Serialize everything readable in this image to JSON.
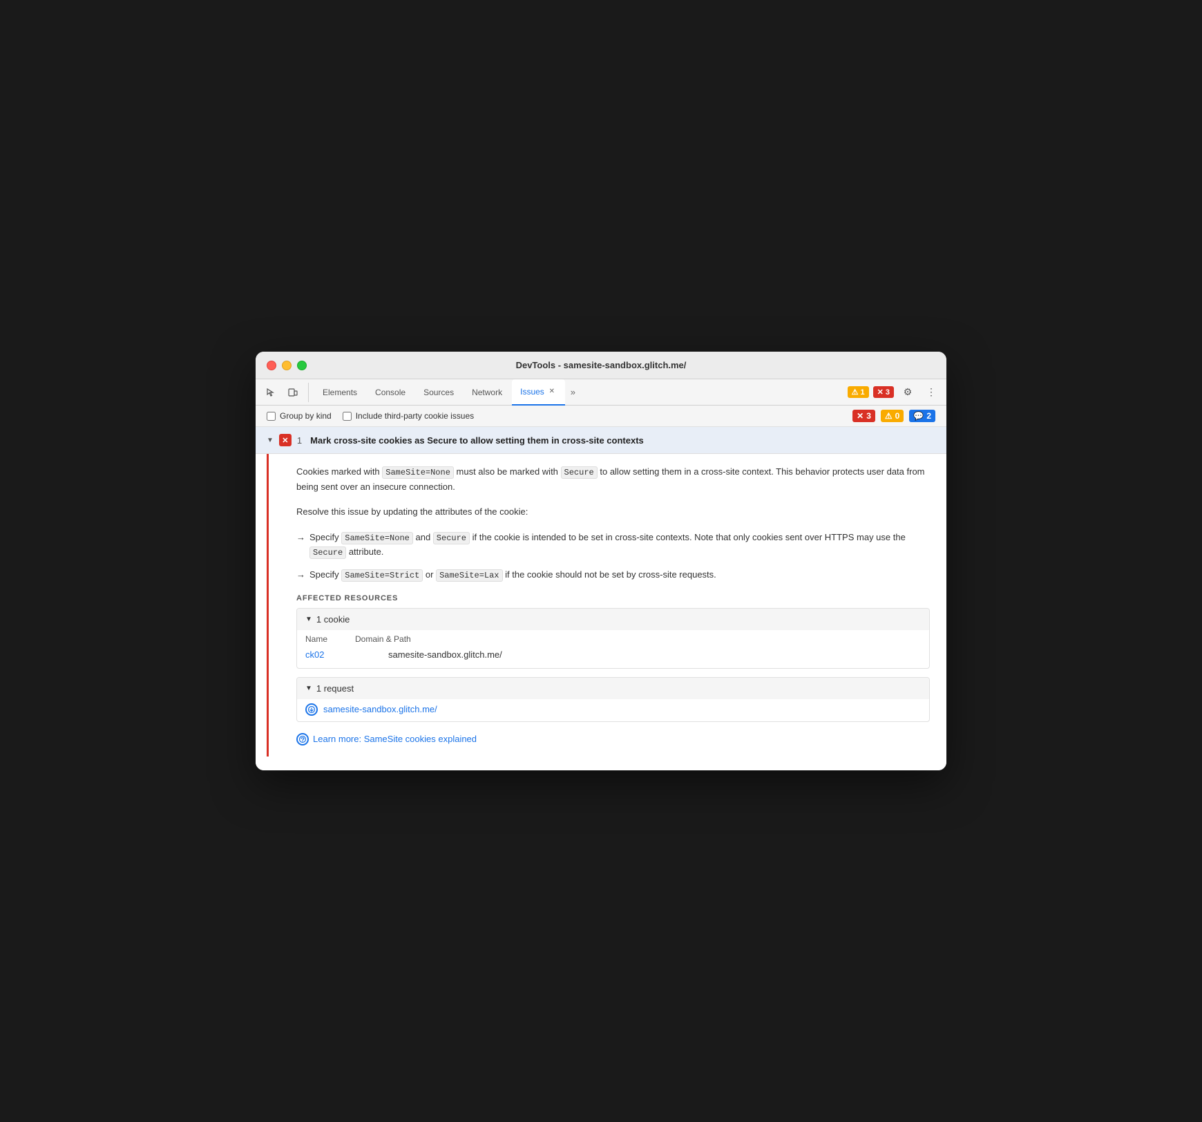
{
  "window": {
    "title": "DevTools - samesite-sandbox.glitch.me/"
  },
  "tabs": [
    {
      "id": "elements",
      "label": "Elements",
      "active": false,
      "closable": false
    },
    {
      "id": "console",
      "label": "Console",
      "active": false,
      "closable": false
    },
    {
      "id": "sources",
      "label": "Sources",
      "active": false,
      "closable": false
    },
    {
      "id": "network",
      "label": "Network",
      "active": false,
      "closable": false
    },
    {
      "id": "issues",
      "label": "Issues",
      "active": true,
      "closable": true
    }
  ],
  "more_tabs_label": "»",
  "badge_warning": {
    "icon": "⚠",
    "count": "1"
  },
  "badge_error": {
    "icon": "✕",
    "count": "3"
  },
  "filter": {
    "group_by_kind_label": "Group by kind",
    "third_party_label": "Include third-party cookie issues",
    "counts": {
      "errors": "3",
      "warnings": "0",
      "info": "2"
    }
  },
  "issue": {
    "arrow": "▼",
    "count": "1",
    "title": "Mark cross-site cookies as Secure to allow setting them in cross-site contexts",
    "description_parts": [
      "Cookies marked with ",
      "SameSite=None",
      " must also be marked with ",
      "Secure",
      " to allow setting them in a cross-site context. This behavior protects user data from being sent over an insecure connection."
    ],
    "resolve_intro": "Resolve this issue by updating the attributes of the cookie:",
    "bullet1_intro": "Specify ",
    "bullet1_code1": "SameSite=None",
    "bullet1_mid": " and ",
    "bullet1_code2": "Secure",
    "bullet1_end": " if the cookie is intended to be set in cross-site contexts. Note that only cookies sent over HTTPS may use the ",
    "bullet1_code3": "Secure",
    "bullet1_end2": " attribute.",
    "bullet2_intro": "Specify ",
    "bullet2_code1": "SameSite=Strict",
    "bullet2_mid": " or ",
    "bullet2_code2": "SameSite=Lax",
    "bullet2_end": " if the cookie should not be set by cross-site requests.",
    "affected_resources_label": "AFFECTED RESOURCES",
    "cookie_section": {
      "arrow": "▼",
      "label": "1 cookie",
      "col1": "Name",
      "col2": "Domain & Path",
      "cookie_name": "ck02",
      "cookie_domain": "samesite-sandbox.glitch.me/"
    },
    "request_section": {
      "arrow": "▼",
      "label": "1 request",
      "url": "samesite-sandbox.glitch.me/"
    },
    "learn_more_label": "Learn more: SameSite cookies explained"
  },
  "icons": {
    "cursor": "⬚",
    "inspect": "⬚",
    "gear": "⚙",
    "more": "⋮"
  }
}
